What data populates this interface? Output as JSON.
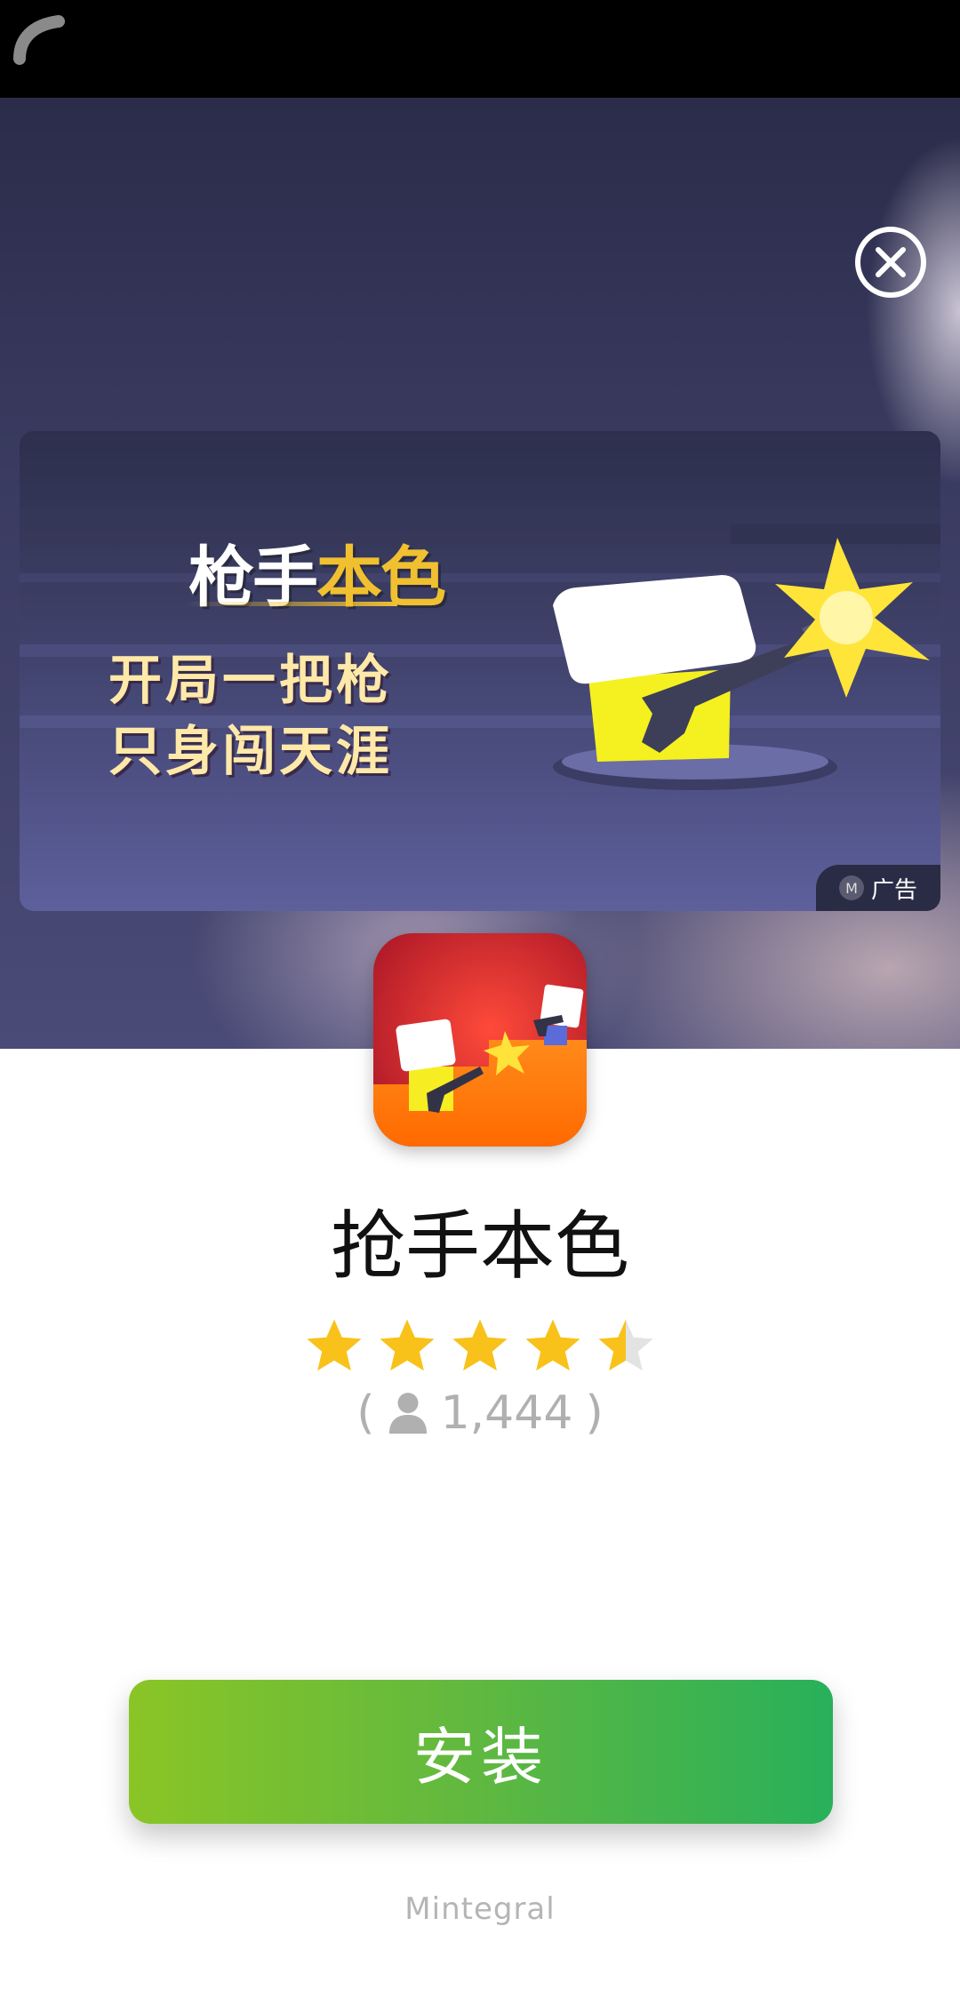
{
  "status_bar": {
    "loader_icon": "arc-spinner-icon"
  },
  "ad": {
    "close_icon": "close-circle-icon",
    "banner": {
      "logo_text_white": "枪手",
      "logo_text_gold": "本色",
      "line1": "开局一把枪",
      "line2": "只身闯天涯",
      "ad_badge_icon": "M",
      "ad_badge_label": "广告"
    }
  },
  "app": {
    "name": "抢手本色",
    "rating_value": 4.5,
    "rating_max": 5,
    "rating_count": "1,444",
    "rating_open": "(",
    "rating_close": ")"
  },
  "install_button": {
    "label": "安装"
  },
  "footer": {
    "brand": "Mintegral"
  },
  "colors": {
    "install_start": "#8ac526",
    "install_end": "#28b05a",
    "star": "#f8c21b",
    "star_empty": "#e3e3e3"
  }
}
